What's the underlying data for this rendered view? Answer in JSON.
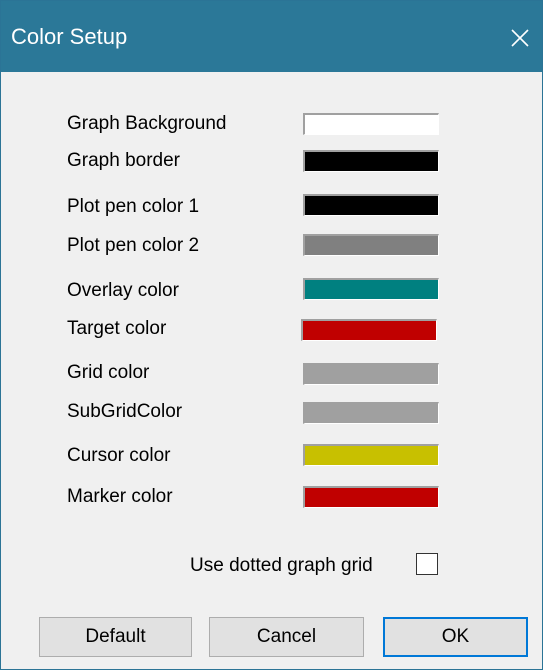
{
  "window": {
    "title": "Color Setup"
  },
  "rows": [
    {
      "label": "Graph Background",
      "color": "#ffffff"
    },
    {
      "label": "Graph border",
      "color": "#000000"
    },
    {
      "label": "Plot pen color 1",
      "color": "#000000"
    },
    {
      "label": "Plot pen color 2",
      "color": "#808080"
    },
    {
      "label": "Overlay color",
      "color": "#008080"
    },
    {
      "label": "Target color",
      "color": "#c00000"
    },
    {
      "label": "Grid color",
      "color": "#a0a0a0"
    },
    {
      "label": "SubGridColor",
      "color": "#a0a0a0"
    },
    {
      "label": "Cursor color",
      "color": "#c8c000"
    },
    {
      "label": "Marker color",
      "color": "#c00000"
    }
  ],
  "options": {
    "dotted_grid_label": "Use dotted graph grid",
    "dotted_grid_checked": false
  },
  "buttons": {
    "default_label": "Default",
    "cancel_label": "Cancel",
    "ok_label": "OK"
  },
  "colors": {
    "titlebar": "#2b7898",
    "dialog_bg": "#f0f0f0",
    "focus_border": "#0078d7"
  }
}
